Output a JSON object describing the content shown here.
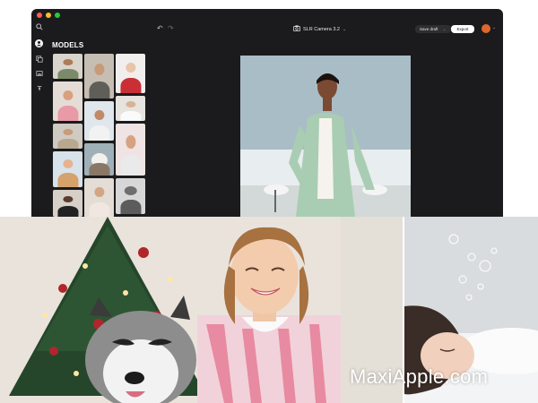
{
  "window": {
    "traffic_lights": [
      "#ff5f57",
      "#febc2e",
      "#28c840"
    ]
  },
  "sidebar": {
    "icons": [
      "search-icon",
      "person-icon",
      "copy-icon",
      "image-icon",
      "adjust-icon"
    ]
  },
  "panel": {
    "title": "MODELS"
  },
  "toolbar": {
    "camera_label": "SLR Camera 3.2",
    "save_draft_label": "Save draft",
    "export_label": "Export"
  },
  "watermark": {
    "text": "MaxiApple.com"
  }
}
